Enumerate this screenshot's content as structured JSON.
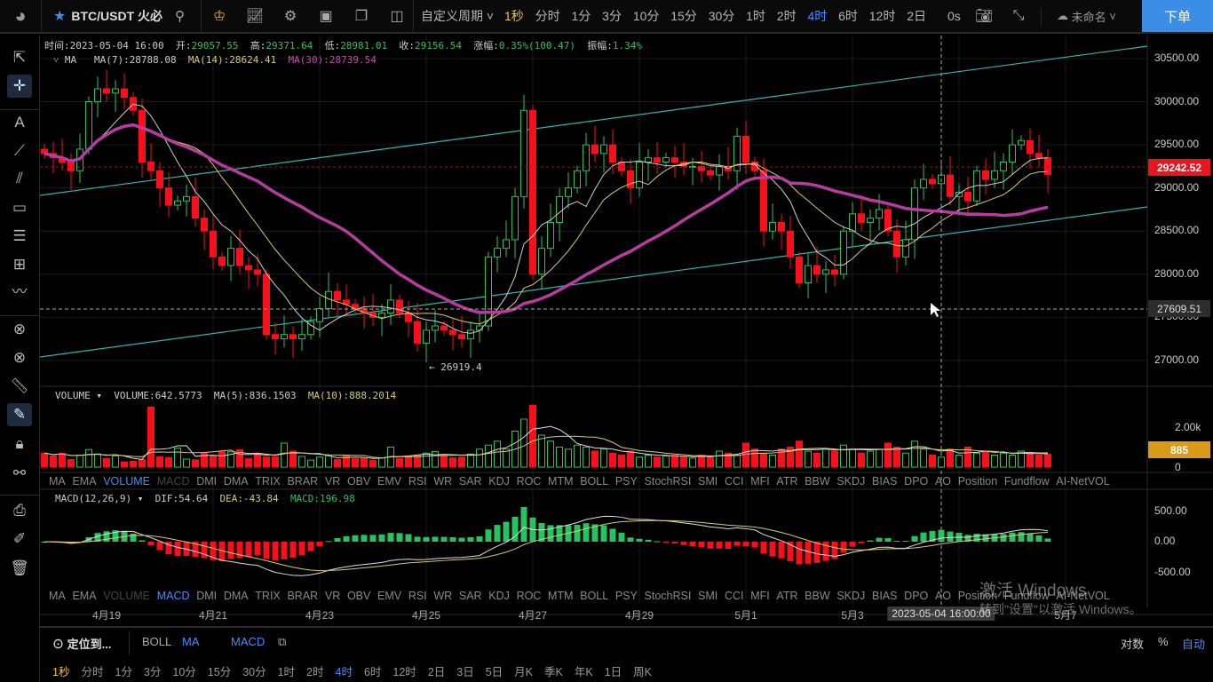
{
  "topbar": {
    "symbol": "BTC/USDT 火必",
    "custom_period": "自定义周期",
    "periods": [
      "1秒",
      "分时",
      "1分",
      "3分",
      "10分",
      "15分",
      "30分",
      "1时",
      "2时",
      "4时",
      "6时",
      "12时",
      "2日"
    ],
    "active_period": "4时",
    "countdown": "0s",
    "layout_name": "未命名",
    "order_button": "下单"
  },
  "info": {
    "time_label": "时间:",
    "time": "2023-05-04 16:00",
    "open_label": "开:",
    "open": "29057.55",
    "high_label": "高:",
    "high": "29371.64",
    "low_label": "低:",
    "low": "28981.01",
    "close_label": "收:",
    "close": "29156.54",
    "change_label": "涨幅:",
    "change": "0.35%(100.47)",
    "amp_label": "振幅:",
    "amp": "1.34%"
  },
  "ma_legend": {
    "name": "MA",
    "ma7": "MA(7):28788.08",
    "ma14": "MA(14):28624.41",
    "ma30": "MA(30):28739.54"
  },
  "volume_legend": {
    "name": "VOLUME",
    "volume": "VOLUME:642.5773",
    "ma5": "MA(5):836.1503",
    "ma10": "MA(10):888.2014"
  },
  "macd_legend": {
    "name": "MACD(12,26,9)",
    "dif": "DIF:54.64",
    "dea": "DEA:-43.84",
    "macd": "MACD:196.98"
  },
  "indicators": [
    "MA",
    "EMA",
    "VOLUME",
    "MACD",
    "DMI",
    "DMA",
    "TRIX",
    "BRAR",
    "VR",
    "OBV",
    "EMV",
    "RSI",
    "WR",
    "SAR",
    "KDJ",
    "ROC",
    "MTM",
    "BOLL",
    "PSY",
    "StochRSI",
    "SMI",
    "CCI",
    "MFI",
    "ATR",
    "BBW",
    "SKDJ",
    "BIAS",
    "DPO",
    "AO",
    "Position",
    "Fundflow",
    "AI-NetVOL"
  ],
  "price_axis": [
    "30500.00",
    "30000.00",
    "29500.00",
    "29000.00",
    "28500.00",
    "28000.00",
    "27500.00",
    "27000.00"
  ],
  "last_price": "29242.52",
  "crosshair_price": "27609.51",
  "low_marker": "← 26919.4",
  "volume_axis": {
    "top": "2.00k",
    "zero": "0",
    "current": "885"
  },
  "macd_axis": [
    "500.00",
    "0.00",
    "-500.00"
  ],
  "dates": [
    "4月19",
    "4月21",
    "4月23",
    "4月25",
    "4月27",
    "4月29",
    "5月1",
    "5月3",
    "5月7"
  ],
  "crosshair_date": "2023-05-04 16:00:00",
  "bottom": {
    "locate": "定位到...",
    "main_inds": [
      "BOLL",
      "MA"
    ],
    "sub_inds": [
      "MACD"
    ],
    "log": "对数",
    "percent": "%",
    "auto": "自动",
    "periods": [
      "1秒",
      "分时",
      "1分",
      "3分",
      "10分",
      "15分",
      "30分",
      "1时",
      "2时",
      "4时",
      "6时",
      "12时",
      "2日",
      "3日",
      "5日",
      "月K",
      "季K",
      "年K",
      "1日",
      "周K"
    ]
  },
  "watermark": {
    "line1": "激活 Windows",
    "line2": "转到\"设置\"以激活 Windows。"
  },
  "colors": {
    "up": "#26c35e",
    "down": "#f5101c",
    "ma7": "#cfcfcf",
    "ma14": "#d6cc6e",
    "ma30": "#b83c9f",
    "trend": "#2fb5b5",
    "accent": "#4a8cf7"
  },
  "chart_data": {
    "type": "candlestick",
    "interval": "4h",
    "ylim": [
      26700,
      30900
    ],
    "closes": [
      29400,
      29350,
      29300,
      29200,
      29450,
      30000,
      30150,
      30100,
      30150,
      30050,
      29900,
      29300,
      29200,
      29000,
      28800,
      28850,
      28900,
      28650,
      28500,
      28200,
      28100,
      28300,
      28100,
      28050,
      28000,
      27300,
      27250,
      27300,
      27250,
      27300,
      27450,
      27600,
      27800,
      27700,
      27650,
      27600,
      27550,
      27500,
      27550,
      27700,
      27550,
      27450,
      27200,
      27350,
      27400,
      27350,
      27300,
      27250,
      27350,
      27400,
      28200,
      28300,
      28400,
      28900,
      29900,
      28000,
      28300,
      28600,
      28900,
      29000,
      29200,
      29500,
      29400,
      29500,
      29300,
      29200,
      29000,
      29300,
      29350,
      29300,
      29350,
      29300,
      29250,
      29250,
      29200,
      29150,
      29250,
      29200,
      29600,
      29300,
      29200,
      28500,
      28600,
      28500,
      28200,
      27900,
      28100,
      28000,
      28050,
      28000,
      28500,
      28700,
      28600,
      28650,
      28750,
      28500,
      28200,
      28400,
      29000,
      29100,
      29050,
      29150,
      28900,
      28950,
      28850,
      29200,
      29100,
      29200,
      29300,
      29500,
      29550,
      29400,
      29350,
      29156.54
    ],
    "volumes": [
      700,
      560,
      700,
      380,
      600,
      880,
      660,
      420,
      560,
      260,
      300,
      380,
      3000,
      520,
      480,
      950,
      400,
      360,
      700,
      560,
      770,
      770,
      860,
      420,
      680,
      500,
      520,
      1200,
      800,
      540,
      350,
      500,
      600,
      380,
      600,
      420,
      430,
      330,
      460,
      1000,
      420,
      560,
      600,
      700,
      780,
      560,
      460,
      500,
      650,
      900,
      1100,
      1300,
      900,
      1800,
      2400,
      3100,
      1600,
      1300,
      1000,
      900,
      1100,
      1000,
      800,
      900,
      700,
      600,
      800,
      500,
      600,
      500,
      550,
      600,
      500,
      450,
      600,
      500,
      800,
      700,
      600,
      1200,
      900,
      700,
      600,
      900,
      1000,
      1300,
      800,
      700,
      900,
      800,
      1100,
      900,
      700,
      800,
      900,
      1200,
      1000,
      700,
      1300,
      900,
      600,
      500,
      900,
      600,
      1000,
      700,
      800,
      600,
      700,
      600,
      800,
      700,
      600,
      642
    ]
  }
}
